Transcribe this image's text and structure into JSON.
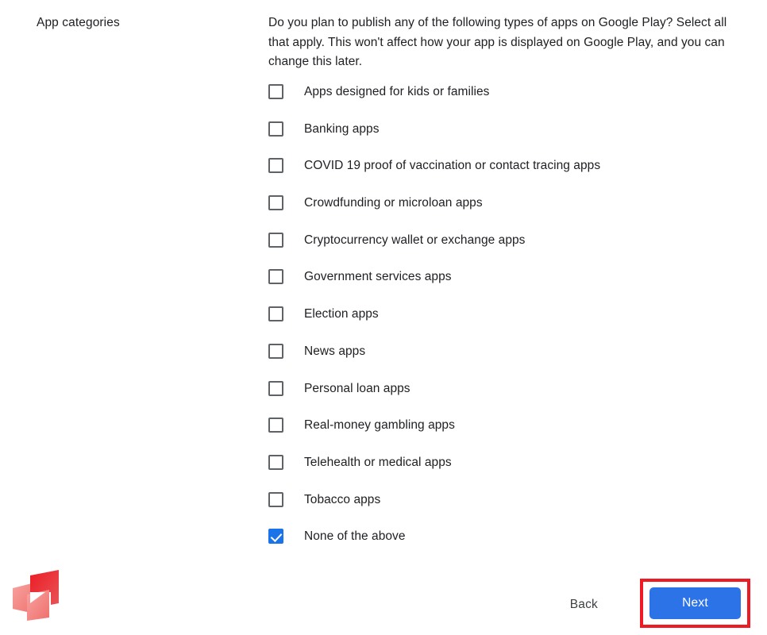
{
  "section": {
    "title": "App categories"
  },
  "description": "Do you plan to publish any of the following types of apps on Google Play? Select all that apply. This won't affect how your app is displayed on Google Play, and you can change this later.",
  "checkboxes": [
    {
      "label": "Apps designed for kids or families",
      "checked": false
    },
    {
      "label": "Banking apps",
      "checked": false
    },
    {
      "label": "COVID 19 proof of vaccination or contact tracing apps",
      "checked": false
    },
    {
      "label": "Crowdfunding or microloan apps",
      "checked": false
    },
    {
      "label": "Cryptocurrency wallet or exchange apps",
      "checked": false
    },
    {
      "label": "Government services apps",
      "checked": false
    },
    {
      "label": "Election apps",
      "checked": false
    },
    {
      "label": "News apps",
      "checked": false
    },
    {
      "label": "Personal loan apps",
      "checked": false
    },
    {
      "label": "Real-money gambling apps",
      "checked": false
    },
    {
      "label": "Telehealth or medical apps",
      "checked": false
    },
    {
      "label": "Tobacco apps",
      "checked": false
    },
    {
      "label": "None of the above",
      "checked": true
    }
  ],
  "footer": {
    "back_label": "Back",
    "next_label": "Next"
  },
  "colors": {
    "accent_blue": "#2d73e8",
    "checkbox_checked": "#1a73e8",
    "highlight_red": "#ee1b24",
    "logo_red_dark": "#e8212c",
    "logo_red_light": "#f4817f",
    "text": "#202124",
    "background": "#ffffff"
  },
  "icons": {
    "logo": "app-logo-icon",
    "checkmark": "check-icon"
  }
}
